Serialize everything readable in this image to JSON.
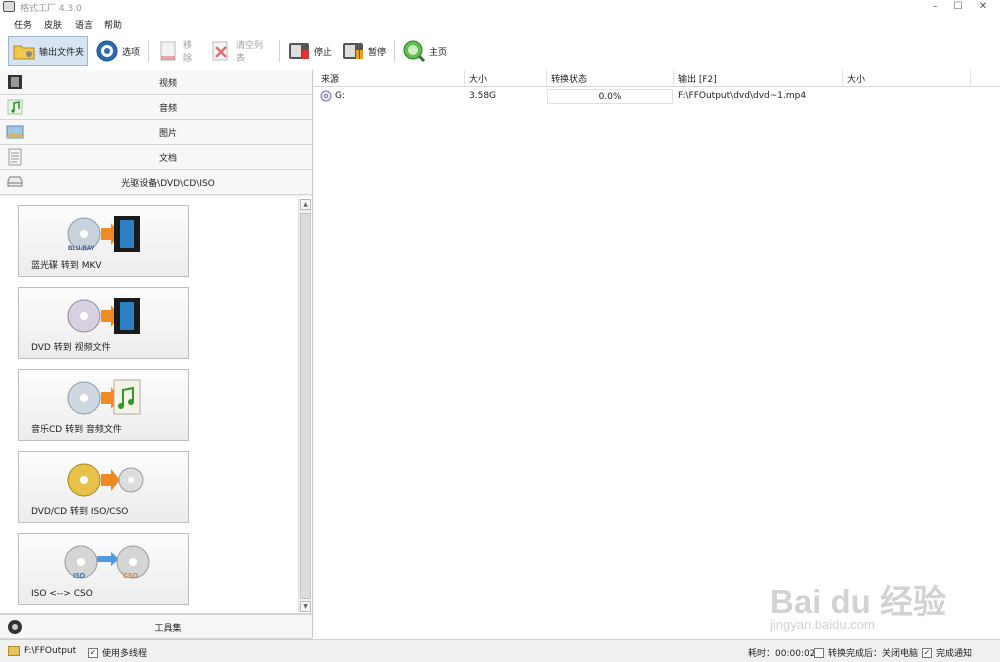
{
  "window": {
    "title": "格式工厂 4.3.0",
    "minimize": "–",
    "maximize": "☐",
    "close": "✕"
  },
  "menu": [
    "任务",
    "皮肤",
    "语言",
    "帮助"
  ],
  "toolbar": {
    "output_folder": "输出文件夹",
    "options": "选项",
    "remove": "移除",
    "clear_list": "清空列表",
    "stop": "停止",
    "pause": "暂停",
    "home": "主页"
  },
  "categories": {
    "video": "视频",
    "audio": "音频",
    "image": "图片",
    "document": "文档",
    "disc": "光驱设备\\DVD\\CD\\ISO",
    "toolbox": "工具集"
  },
  "disc_tools": [
    {
      "label": "蓝光碟 转到 MKV",
      "icon": "bluray-to-video-icon"
    },
    {
      "label": "DVD 转到 视频文件",
      "icon": "dvd-to-video-icon"
    },
    {
      "label": "音乐CD 转到 音频文件",
      "icon": "cd-to-audio-icon"
    },
    {
      "label": "DVD/CD 转到 ISO/CSO",
      "icon": "disc-to-iso-icon"
    },
    {
      "label": "ISO <--> CSO",
      "icon": "iso-cso-icon"
    }
  ],
  "table": {
    "headers": [
      "来源",
      "大小",
      "转换状态",
      "输出 [F2]",
      "大小"
    ],
    "rows": [
      {
        "source": "G:",
        "size": "3.58G",
        "status": "0.0%",
        "progress": 0.0,
        "output": "F:\\FFOutput\\dvd\\dvd~1.mp4",
        "output_size": ""
      }
    ]
  },
  "status_bar": {
    "output_path": "F:\\FFOutput",
    "multithread_label": "使用多线程",
    "multithread_checked": true,
    "elapsed": "耗时：00:00:02",
    "after_convert": "转换完成后：关闭电脑",
    "after_convert_checked": false,
    "notify_label": "完成通知",
    "notify_checked": true
  },
  "watermark": {
    "text": "Bai du 经验",
    "sub": "jingyan.baidu.com"
  },
  "colors": {
    "progress": "#7ec46c",
    "toolbar_active": "#d7e4f2"
  }
}
